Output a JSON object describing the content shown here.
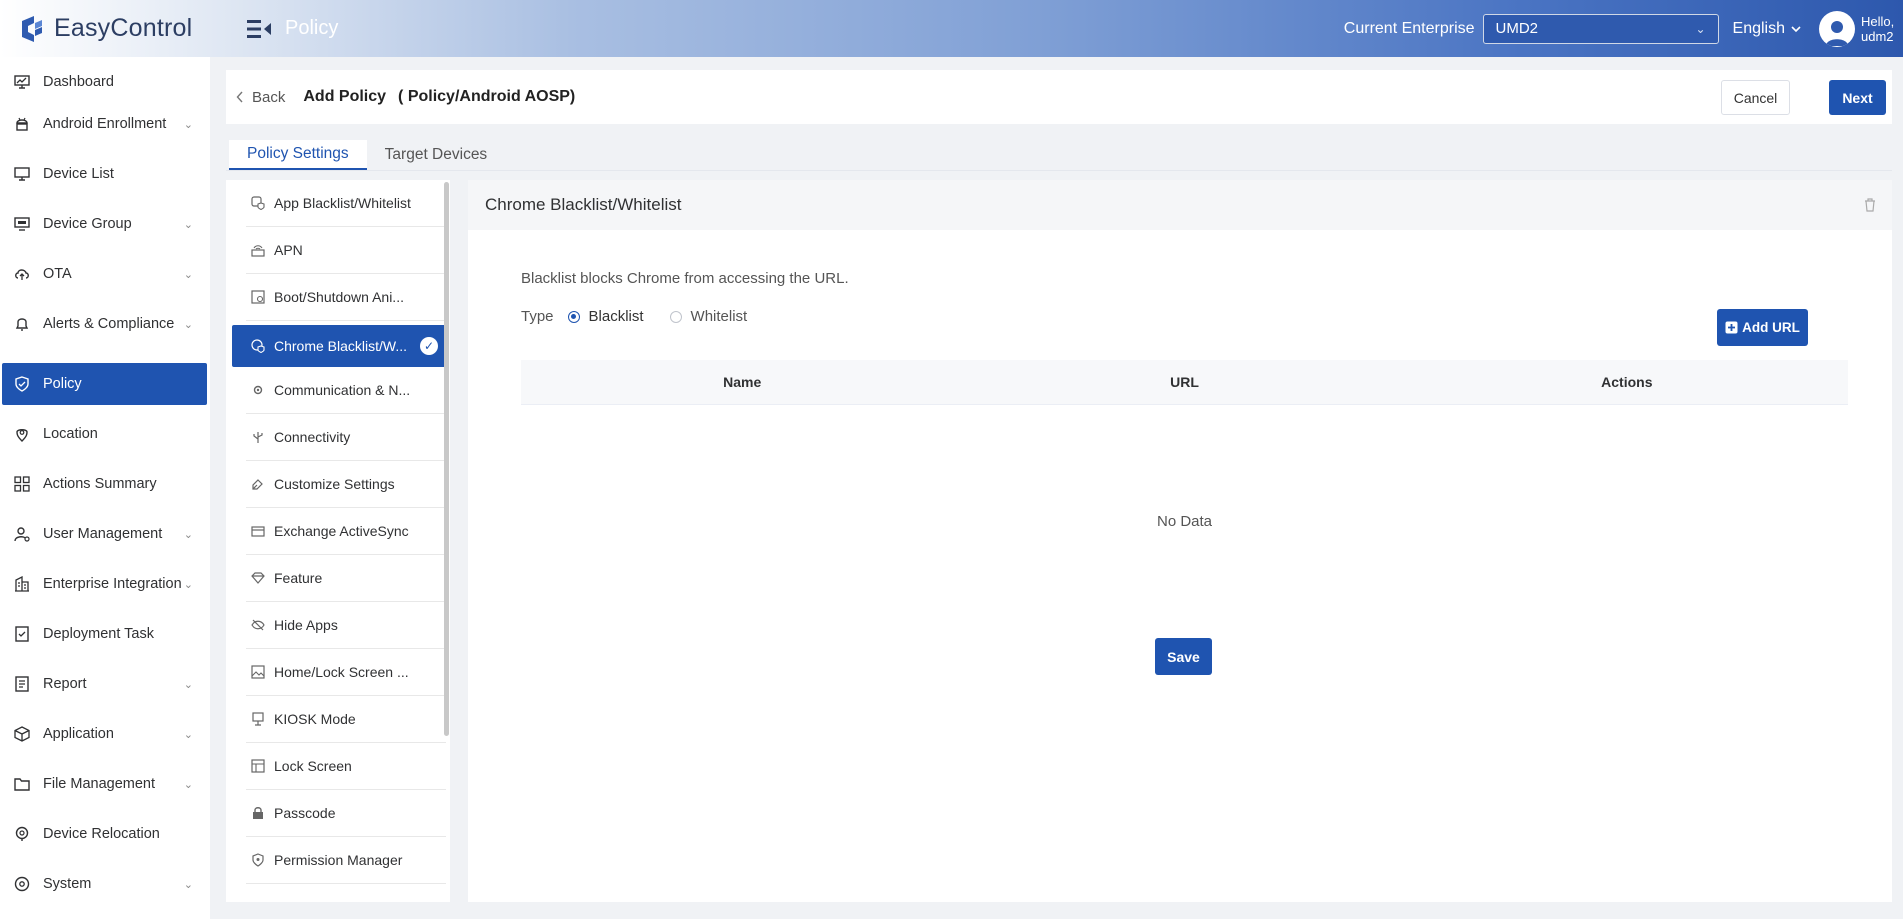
{
  "app": {
    "name": "EasyControl",
    "module": "Policy"
  },
  "header": {
    "enterprise_label": "Current Enterprise",
    "enterprise_value": "UMD2",
    "language": "English",
    "greeting_line1": "Hello,",
    "greeting_line2": "udm2"
  },
  "sidebar": {
    "items": [
      {
        "label": "Dashboard",
        "icon": "dashboard-icon",
        "expandable": false
      },
      {
        "label": "Android Enrollment",
        "icon": "android-icon",
        "expandable": true
      },
      {
        "label": "Device List",
        "icon": "monitor-icon",
        "expandable": false
      },
      {
        "label": "Device Group",
        "icon": "device-group-icon",
        "expandable": true
      },
      {
        "label": "OTA",
        "icon": "cloud-upload-icon",
        "expandable": true
      },
      {
        "label": "Alerts & Compliance",
        "icon": "bell-icon",
        "expandable": true
      },
      {
        "label": "Policy",
        "icon": "shield-icon",
        "expandable": false,
        "active": true
      },
      {
        "label": "Location",
        "icon": "location-pin-icon",
        "expandable": false
      },
      {
        "label": "Actions Summary",
        "icon": "grid-icon",
        "expandable": false
      },
      {
        "label": "User Management",
        "icon": "user-gear-icon",
        "expandable": true
      },
      {
        "label": "Enterprise Integration",
        "icon": "building-icon",
        "expandable": true
      },
      {
        "label": "Deployment Task",
        "icon": "task-icon",
        "expandable": false
      },
      {
        "label": "Report",
        "icon": "report-icon",
        "expandable": true
      },
      {
        "label": "Application",
        "icon": "cube-icon",
        "expandable": true
      },
      {
        "label": "File Management",
        "icon": "folder-icon",
        "expandable": true
      },
      {
        "label": "Device Relocation",
        "icon": "relocation-pin-icon",
        "expandable": false
      },
      {
        "label": "System",
        "icon": "system-icon",
        "expandable": true
      }
    ]
  },
  "page": {
    "back_label": "Back",
    "title": "Add Policy",
    "subtitle": "( Policy/Android AOSP)",
    "cancel_label": "Cancel",
    "next_label": "Next"
  },
  "tabs": [
    {
      "label": "Policy Settings",
      "active": true
    },
    {
      "label": "Target Devices",
      "active": false
    }
  ],
  "policy_list": [
    {
      "label": "App Blacklist/Whitelist",
      "icon": "app-shield-icon"
    },
    {
      "label": "APN",
      "icon": "apn-icon"
    },
    {
      "label": "Boot/Shutdown Ani...",
      "icon": "boot-animation-icon"
    },
    {
      "label": "Chrome Blacklist/W...",
      "icon": "chrome-shield-icon",
      "active": true
    },
    {
      "label": "Communication & N...",
      "icon": "communication-icon"
    },
    {
      "label": "Connectivity",
      "icon": "usb-icon"
    },
    {
      "label": "Customize Settings",
      "icon": "customize-icon"
    },
    {
      "label": "Exchange ActiveSync",
      "icon": "exchange-icon"
    },
    {
      "label": "Feature",
      "icon": "diamond-icon"
    },
    {
      "label": "Hide Apps",
      "icon": "eye-off-icon"
    },
    {
      "label": "Home/Lock Screen ...",
      "icon": "image-icon"
    },
    {
      "label": "KIOSK Mode",
      "icon": "kiosk-icon"
    },
    {
      "label": "Lock Screen",
      "icon": "lock-screen-icon"
    },
    {
      "label": "Passcode",
      "icon": "lock-icon"
    },
    {
      "label": "Permission Manager",
      "icon": "permission-shield-icon"
    }
  ],
  "section": {
    "title": "Chrome Blacklist/Whitelist",
    "description": "Blacklist blocks Chrome from accessing the URL.",
    "type_label": "Type",
    "options": [
      {
        "label": "Blacklist",
        "selected": true
      },
      {
        "label": "Whitelist",
        "selected": false
      }
    ],
    "add_url_label": "Add URL",
    "table": {
      "columns": [
        "Name",
        "URL",
        "Actions"
      ],
      "rows": [],
      "empty_text": "No Data"
    },
    "save_label": "Save"
  },
  "colors": {
    "primary": "#1f54b0",
    "header_gradient_end": "#2d58ad",
    "background": "#f0f2f5"
  }
}
